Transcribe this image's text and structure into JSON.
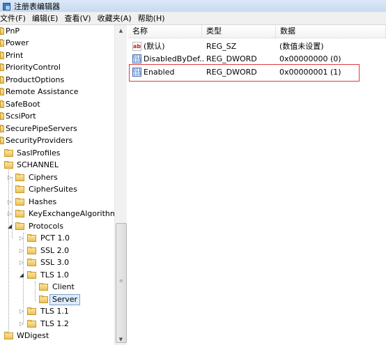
{
  "window": {
    "title": "注册表编辑器"
  },
  "menu": [
    "文件(F)",
    "编辑(E)",
    "查看(V)",
    "收藏夹(A)",
    "帮助(H)"
  ],
  "tree": {
    "items": [
      {
        "label": "PnP"
      },
      {
        "label": "Power"
      },
      {
        "label": "Print"
      },
      {
        "label": "PriorityControl"
      },
      {
        "label": "ProductOptions"
      },
      {
        "label": "Remote Assistance"
      },
      {
        "label": "SafeBoot"
      },
      {
        "label": "ScsiPort"
      },
      {
        "label": "SecurePipeServers"
      },
      {
        "label": "SecurityProviders"
      },
      {
        "label": "SaslProfiles"
      },
      {
        "label": "SCHANNEL"
      },
      {
        "label": "Ciphers"
      },
      {
        "label": "CipherSuites"
      },
      {
        "label": "Hashes"
      },
      {
        "label": "KeyExchangeAlgorithms"
      },
      {
        "label": "Protocols"
      },
      {
        "label": "PCT 1.0"
      },
      {
        "label": "SSL 2.0"
      },
      {
        "label": "SSL 3.0"
      },
      {
        "label": "TLS 1.0"
      },
      {
        "label": "Client"
      },
      {
        "label": "Server"
      },
      {
        "label": "TLS 1.1"
      },
      {
        "label": "TLS 1.2"
      },
      {
        "label": "WDigest"
      }
    ],
    "selected": "Server"
  },
  "list": {
    "columns": [
      "名称",
      "类型",
      "数据"
    ],
    "rows": [
      {
        "icon": "string-value-icon",
        "name": "(默认)",
        "type": "REG_SZ",
        "data": "(数值未设置)"
      },
      {
        "icon": "dword-value-icon",
        "name": "DisabledByDef...",
        "type": "REG_DWORD",
        "data": "0x00000000 (0)"
      },
      {
        "icon": "dword-value-icon",
        "name": "Enabled",
        "type": "REG_DWORD",
        "data": "0x00000001 (1)"
      }
    ]
  },
  "icons": {
    "string_icon_text": "ab",
    "dword_icon_text": "011 110"
  },
  "colors": {
    "highlight_border": "#e0393a",
    "selection_bg": "#dcebfc",
    "folder": "#e9c25a"
  }
}
